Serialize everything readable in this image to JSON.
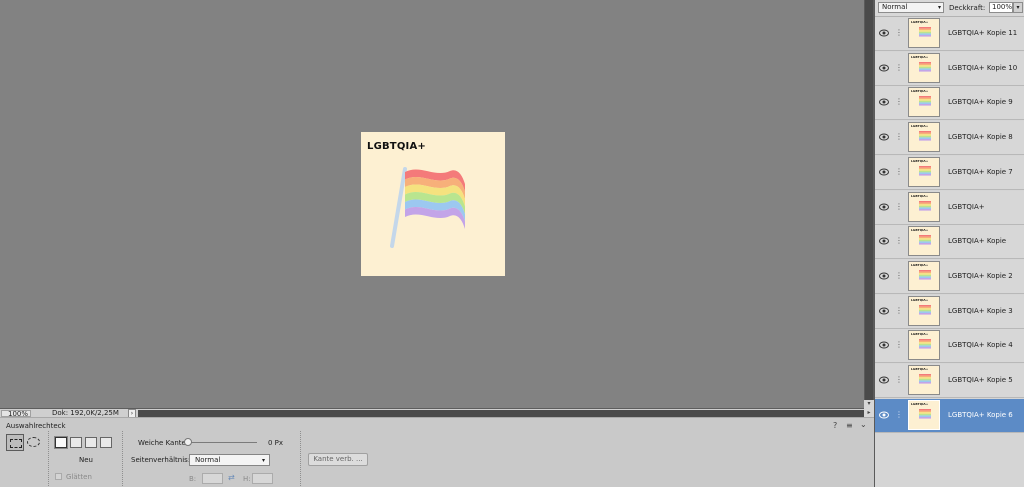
{
  "status": {
    "zoom": "100%",
    "doc_info": "Dok: 192,0K/2,25M",
    "arrow": "›"
  },
  "document": {
    "title": "LGBTQIA+",
    "background_color": "#fdf0d2",
    "flag_colors": [
      "#f47a7a",
      "#f7b07a",
      "#f5e27f",
      "#b9e58f",
      "#9cc8f0",
      "#c3a4e8"
    ],
    "pole_color": "#c4d7ea"
  },
  "layers_panel": {
    "blend_mode": "Normal",
    "opacity_label": "Deckkraft:",
    "opacity_value": "100%",
    "layers": [
      {
        "name": "LGBTQIA+ Kopie 11",
        "selected": false
      },
      {
        "name": "LGBTQIA+ Kopie 10",
        "selected": false
      },
      {
        "name": "LGBTQIA+ Kopie 9",
        "selected": false
      },
      {
        "name": "LGBTQIA+ Kopie 8",
        "selected": false
      },
      {
        "name": "LGBTQIA+ Kopie 7",
        "selected": false
      },
      {
        "name": "LGBTQIA+",
        "selected": false
      },
      {
        "name": "LGBTQIA+ Kopie",
        "selected": false
      },
      {
        "name": "LGBTQIA+ Kopie 2",
        "selected": false
      },
      {
        "name": "LGBTQIA+ Kopie 3",
        "selected": false
      },
      {
        "name": "LGBTQIA+ Kopie 4",
        "selected": false
      },
      {
        "name": "LGBTQIA+ Kopie 5",
        "selected": false
      },
      {
        "name": "LGBTQIA+ Kopie 6",
        "selected": true
      }
    ],
    "selected_color": "#5c8bc6"
  },
  "tool_options": {
    "tool_name": "Auswahlrechteck",
    "mode_label": "Neu",
    "smooth_label": "Glätten",
    "feather_label": "Weiche Kante:",
    "feather_value": "0 Px",
    "aspect_label": "Seitenverhältnis:",
    "aspect_value": "Normal",
    "width_label": "B:",
    "height_label": "H:",
    "refine_button": "Kante verb. ...",
    "help_icon": "?",
    "menu_icon": "≡",
    "collapse_icon": "⌄"
  }
}
